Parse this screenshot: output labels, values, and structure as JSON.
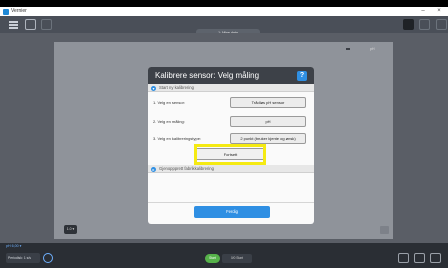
{
  "window": {
    "app_title": "Vernier",
    "minimize": "–",
    "close": "×"
  },
  "toolbar": {
    "tab_label": "1: Mine data"
  },
  "graph": {
    "label": "pH"
  },
  "scale_button": "1.0 ▾",
  "dialog": {
    "title": "Kalibrere sensor: Velg måling",
    "help": "?",
    "section_start": "Start ny kalibrering",
    "steps": [
      {
        "label": "1. Velg en sensor:",
        "value": "Trådløs pH sensor"
      },
      {
        "label": "2. Velg en måling:",
        "value": "pH"
      },
      {
        "label": "3. Velg en kalibreringstype:",
        "value": "2 punkt (bruker kjente og ønsk)"
      }
    ],
    "continue_label": "Fortsett",
    "section_factory": "Gjenoppprett fabrikkalibrering",
    "done_label": "Ferdig"
  },
  "statusbar": {
    "mode_label": "pH 6,00 ▾",
    "mode_value": "Periodisk: 1 s/s",
    "collect_label": "Start",
    "collect_info": "0/0 Start"
  },
  "colors": {
    "accent": "#2f8fe3",
    "highlight": "#f5ea12",
    "collect": "#56b24a"
  }
}
